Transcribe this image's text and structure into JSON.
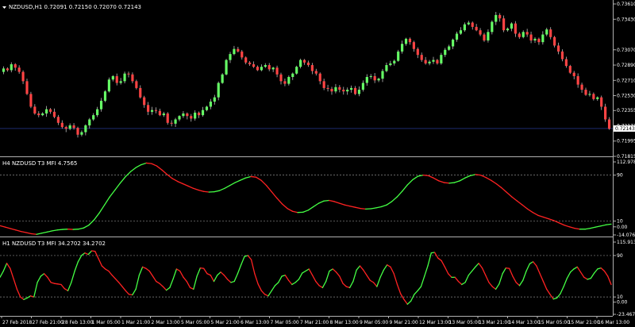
{
  "chart_data": [
    {
      "type": "candlestick",
      "title": "NZDUSD,H1  0.72091 0.72150 0.72070 0.72143",
      "ylim": [
        0.71815,
        0.7361
      ],
      "yticks": [
        "0.73610",
        "0.73430",
        "0.73070",
        "0.72890",
        "0.72710",
        "0.72530",
        "0.72355",
        "0.72173",
        "0.71995",
        "0.71815"
      ],
      "current_price": "0.72143",
      "colors": {
        "up": "#66ff66",
        "down": "#ff4444",
        "wick": "#bbbbbb",
        "current_line": "#1e2a6e"
      },
      "close_path": [
        0.7285,
        0.7283,
        0.729,
        0.7286,
        0.7281,
        0.727,
        0.7255,
        0.724,
        0.7232,
        0.723,
        0.7232,
        0.7237,
        0.7234,
        0.7228,
        0.7221,
        0.7216,
        0.7214,
        0.7218,
        0.7215,
        0.7207,
        0.721,
        0.7218,
        0.7225,
        0.723,
        0.7237,
        0.7247,
        0.7258,
        0.7272,
        0.7276,
        0.7268,
        0.727,
        0.7279,
        0.7278,
        0.727,
        0.7262,
        0.7251,
        0.7242,
        0.7234,
        0.7236,
        0.7235,
        0.723,
        0.7232,
        0.7221,
        0.722,
        0.7225,
        0.7229,
        0.7232,
        0.7229,
        0.7226,
        0.7233,
        0.723,
        0.7236,
        0.724,
        0.7246,
        0.7251,
        0.7268,
        0.7278,
        0.7295,
        0.7302,
        0.7308,
        0.7305,
        0.7298,
        0.7292,
        0.729,
        0.7287,
        0.7283,
        0.7287,
        0.7289,
        0.7284,
        0.7286,
        0.7278,
        0.727,
        0.7267,
        0.7275,
        0.7279,
        0.7287,
        0.7295,
        0.7292,
        0.7289,
        0.7282,
        0.7279,
        0.727,
        0.7262,
        0.7261,
        0.7258,
        0.7263,
        0.726,
        0.7258,
        0.726,
        0.7262,
        0.7255,
        0.726,
        0.7268,
        0.7275,
        0.7276,
        0.7271,
        0.7273,
        0.7282,
        0.7289,
        0.7291,
        0.7294,
        0.7305,
        0.7314,
        0.732,
        0.7316,
        0.7308,
        0.7301,
        0.7295,
        0.7291,
        0.7293,
        0.7295,
        0.7291,
        0.7301,
        0.7307,
        0.7311,
        0.7319,
        0.7326,
        0.733,
        0.7337,
        0.7339,
        0.7334,
        0.733,
        0.7325,
        0.7318,
        0.7328,
        0.734,
        0.7348,
        0.7344,
        0.733,
        0.7332,
        0.7338,
        0.7326,
        0.7322,
        0.7328,
        0.7325,
        0.7318,
        0.732,
        0.7316,
        0.7325,
        0.7331,
        0.7322,
        0.7312,
        0.7305,
        0.7296,
        0.7288,
        0.728,
        0.7276,
        0.7266,
        0.726,
        0.7254,
        0.7255,
        0.7249,
        0.7251,
        0.724,
        0.7225,
        0.7214
      ]
    },
    {
      "type": "line",
      "title": "H4 NZDUSD  T3 MFI 4.7565",
      "ylim": [
        -14.0761,
        112.9786
      ],
      "yticks": [
        "112.9786",
        "90",
        "10",
        "0.00",
        "-14.0761"
      ],
      "levels": [
        90,
        10
      ],
      "colors": {
        "up": "#44ff44",
        "down": "#ff2222",
        "level": "#8a8a8a"
      },
      "values": [
        2.0,
        -0.5,
        -3.0,
        -5.5,
        -8.0,
        -10.0,
        -12.0,
        -13.0,
        -11.0,
        -9.0,
        -7.0,
        -5.5,
        -4.5,
        -4.0,
        -4.5,
        -4.0,
        -2.0,
        3.0,
        12.0,
        24.0,
        38.0,
        52.0,
        64.0,
        76.0,
        87.0,
        96.0,
        103.0,
        108.0,
        111.0,
        110.0,
        106.0,
        99.0,
        91.0,
        84.0,
        79.0,
        75.0,
        71.0,
        67.0,
        64.0,
        61.5,
        60.5,
        61.0,
        63.0,
        67.0,
        72.0,
        77.0,
        81.0,
        85.0,
        87.5,
        86.5,
        81.0,
        72.0,
        61.0,
        50.0,
        40.0,
        32.0,
        27.0,
        25.0,
        25.5,
        29.0,
        35.0,
        41.0,
        45.0,
        46.0,
        44.0,
        41.0,
        38.0,
        36.0,
        34.0,
        32.0,
        31.0,
        31.5,
        33.0,
        35.0,
        38.0,
        44.0,
        52.0,
        62.0,
        73.0,
        82.0,
        88.0,
        90.0,
        89.0,
        85.0,
        80.0,
        77.0,
        76.0,
        77.0,
        80.0,
        85.0,
        89.0,
        91.0,
        90.0,
        86.0,
        81.0,
        75.0,
        68.0,
        60.0,
        52.0,
        45.0,
        38.0,
        31.0,
        25.0,
        20.0,
        17.0,
        14.0,
        11.0,
        7.0,
        3.0,
        0.0,
        -2.5,
        -4.0,
        -4.0,
        -2.5,
        -0.5,
        1.5,
        3.5,
        4.7565
      ]
    },
    {
      "type": "line",
      "title": "H1 NZDUSD  T3 MFI 34.2702 34.2702",
      "ylim": [
        -23.4675,
        115.9137
      ],
      "yticks": [
        "115.9137",
        "90",
        "10",
        "0.00",
        "-23.4675"
      ],
      "levels": [
        90,
        10
      ],
      "colors": {
        "up": "#44ff44",
        "down": "#ff2222",
        "level": "#8a8a8a"
      },
      "values": [
        48,
        60,
        75,
        65,
        45,
        25,
        10,
        5,
        8,
        12,
        10,
        38,
        50,
        55,
        48,
        38,
        36,
        35,
        34,
        26,
        22,
        38,
        60,
        78,
        90,
        95,
        92,
        99,
        98,
        84,
        70,
        64,
        60,
        52,
        45,
        38,
        30,
        22,
        15,
        14,
        25,
        52,
        68,
        65,
        60,
        50,
        40,
        36,
        30,
        23,
        28,
        45,
        64,
        60,
        48,
        40,
        28,
        25,
        50,
        66,
        65,
        55,
        52,
        40,
        52,
        58,
        52,
        44,
        38,
        40,
        55,
        72,
        88,
        90,
        82,
        55,
        35,
        22,
        15,
        12,
        22,
        32,
        38,
        50,
        52,
        42,
        34,
        38,
        44,
        56,
        60,
        64,
        52,
        40,
        32,
        28,
        40,
        60,
        64,
        58,
        50,
        36,
        30,
        28,
        40,
        62,
        70,
        62,
        52,
        42,
        38,
        30,
        48,
        62,
        72,
        68,
        55,
        34,
        16,
        5,
        -4,
        2,
        15,
        22,
        30,
        50,
        70,
        95,
        96,
        85,
        80,
        68,
        55,
        48,
        48,
        40,
        34,
        38,
        52,
        60,
        68,
        75,
        66,
        52,
        38,
        30,
        25,
        35,
        55,
        66,
        65,
        50,
        38,
        32,
        42,
        60,
        74,
        78,
        70,
        55,
        40,
        25,
        15,
        6,
        8,
        16,
        30,
        46,
        58,
        64,
        68,
        58,
        48,
        44,
        46,
        56,
        64,
        66,
        60,
        50,
        34
      ]
    }
  ],
  "x_labels": [
    "27 Feb 2018",
    "27 Feb 21:00",
    "28 Feb 13:00",
    "1 Mar 05:00",
    "1 Mar 21:00",
    "2 Mar 13:00",
    "5 Mar 05:00",
    "5 Mar 21:00",
    "6 Mar 13:00",
    "7 Mar 05:00",
    "7 Mar 21:00",
    "8 Mar 13:00",
    "9 Mar 05:00",
    "9 Mar 21:00",
    "12 Mar 13:00",
    "13 Mar 05:00",
    "13 Mar 21:00",
    "14 Mar 13:00",
    "15 Mar 05:00",
    "15 Mar 21:00",
    "16 Mar 13:00"
  ],
  "colors": {
    "background": "#000000",
    "frame": "#b0b0b0",
    "text": "#ffffff"
  },
  "icons": {
    "menu": "triangle-down-icon"
  }
}
